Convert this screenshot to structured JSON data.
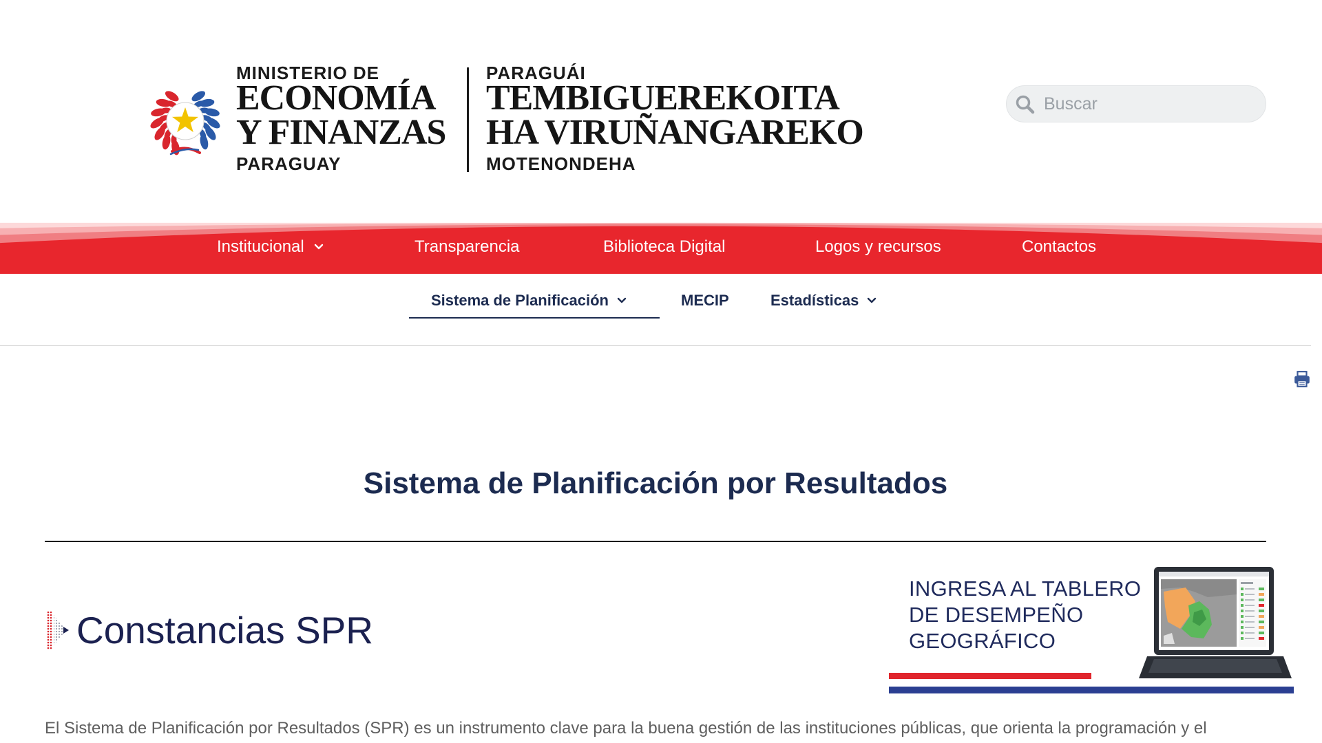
{
  "header": {
    "emblem_icon": "paraguay-coat-of-arms-icon",
    "ministry_logo": {
      "line1": "MINISTERIO DE",
      "line2": "ECONOMÍA",
      "line3": "Y FINANZAS",
      "line4": "PARAGUAY"
    },
    "guarani_logo": {
      "line1": "PARAGUÁI",
      "line2": "TEMBIGUEREKOITA",
      "line3": "HA VIRUÑANGAREKO",
      "line4": "MOTENONDEHA"
    },
    "search": {
      "placeholder": "Buscar",
      "icon": "search-icon"
    }
  },
  "main_nav": {
    "items": [
      {
        "label": "Institucional",
        "has_dropdown": true,
        "icon": "chevron-down-icon"
      },
      {
        "label": "Transparencia",
        "has_dropdown": false
      },
      {
        "label": "Biblioteca Digital",
        "has_dropdown": false
      },
      {
        "label": "Logos y recursos",
        "has_dropdown": false
      },
      {
        "label": "Contactos",
        "has_dropdown": false
      }
    ]
  },
  "sub_nav": {
    "items": [
      {
        "label": "Sistema de Planificación",
        "has_dropdown": true,
        "active": true,
        "icon": "chevron-down-icon"
      },
      {
        "label": "MECIP",
        "has_dropdown": false,
        "active": false
      },
      {
        "label": "Estadísticas",
        "has_dropdown": true,
        "active": false,
        "icon": "chevron-down-icon"
      }
    ]
  },
  "toolbar": {
    "print_icon": "print-icon"
  },
  "content": {
    "title": "Sistema de Planificación por Resultados",
    "section": {
      "icon": "spr-dotted-arrow-icon",
      "heading": "Constancias SPR"
    },
    "dashboard_banner": {
      "lines": [
        "INGRESA AL TABLERO",
        "DE DESEMPEÑO",
        "GEOGRÁFICO"
      ],
      "illustration": "laptop-map-icon"
    },
    "intro_text": "El Sistema de Planificación por Resultados (SPR) es un instrumento clave para la buena gestión de las instituciones públicas, que orienta la programación y el"
  },
  "theme": {
    "nav_red": "#e8262d",
    "navy": "#1c2b50",
    "text_grey": "#5f5f5f",
    "search_bg": "#eef0f1",
    "flag_red": "#e0252c",
    "flag_blue": "#2b3f92",
    "leaf_red": "#d9262d",
    "leaf_blue": "#2a5aa8",
    "star_yellow": "#f2c300"
  }
}
